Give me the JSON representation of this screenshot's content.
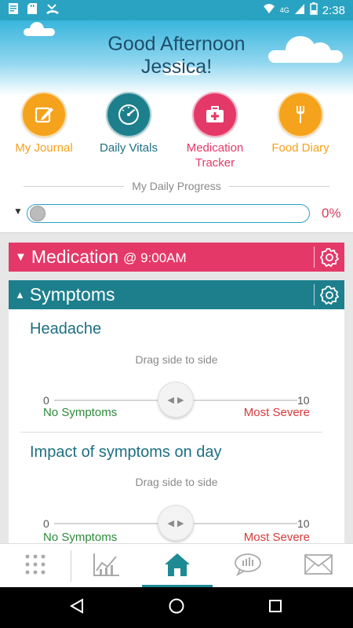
{
  "status_bar": {
    "network": "4G",
    "time": "2:38",
    "icons": [
      "notes-icon",
      "sd-card-icon",
      "missed-call-icon",
      "wifi-icon",
      "signal-icon",
      "battery-icon"
    ]
  },
  "header": {
    "greeting_line1": "Good Afternoon",
    "greeting_line2": "Jessica!"
  },
  "quick_actions": [
    {
      "label": "My Journal",
      "icon": "pencil-note-icon",
      "color": "#f5a21c",
      "text_color": "#f5a21c"
    },
    {
      "label": "Daily Vitals",
      "icon": "gauge-icon",
      "color": "#1d7f8c",
      "text_color": "#1d6f82"
    },
    {
      "label_line1": "Medication",
      "label_line2": "Tracker",
      "icon": "medical-kit-icon",
      "color": "#e43968",
      "text_color": "#e43968"
    },
    {
      "label": "Food Diary",
      "icon": "fork-icon",
      "color": "#f5a21c",
      "text_color": "#f5a21c"
    }
  ],
  "progress": {
    "title": "My Daily Progress",
    "value_label": "0%",
    "value": 0
  },
  "medication": {
    "title": "Medication",
    "time": "@ 9:00AM",
    "color": "#e43968"
  },
  "symptoms": {
    "title": "Symptoms",
    "color": "#1d7f8c",
    "questions": [
      {
        "title": "Headache",
        "hint": "Drag side to side",
        "min": "0",
        "max": "10",
        "min_label": "No Symptoms",
        "max_label": "Most Severe",
        "value": 5
      },
      {
        "title": "Impact of symptoms on day",
        "hint": "Drag side to side",
        "min": "0",
        "max": "10",
        "min_label": "No Symptoms",
        "max_label": "Most Severe",
        "value": 5
      }
    ]
  },
  "bottom_nav": {
    "items": [
      "grid-menu-icon",
      "chart-icon",
      "home-icon",
      "speech-bubble-icon",
      "envelope-icon"
    ],
    "active": "home-icon",
    "accent": "#1d8a94"
  }
}
